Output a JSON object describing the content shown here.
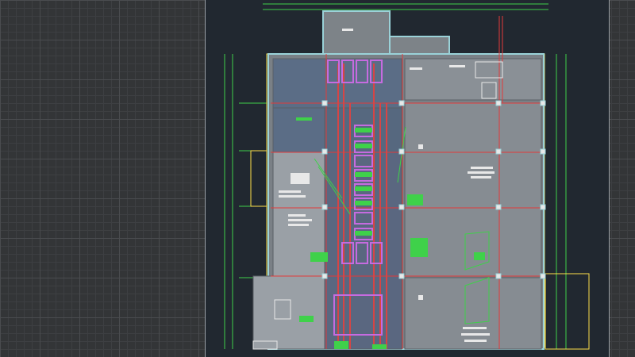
{
  "app": {
    "view": "model-space",
    "background_color": "#333537",
    "sheet_color": "#212830"
  },
  "drawing": {
    "colors": {
      "wall": "#9ad2d8",
      "axis": "#e23a3a",
      "dimension": "#3fd14a",
      "pipe": "#d64545",
      "equipment": "#c66be0",
      "annotation": "#ffffff",
      "highlight": "#ffe14a"
    }
  }
}
